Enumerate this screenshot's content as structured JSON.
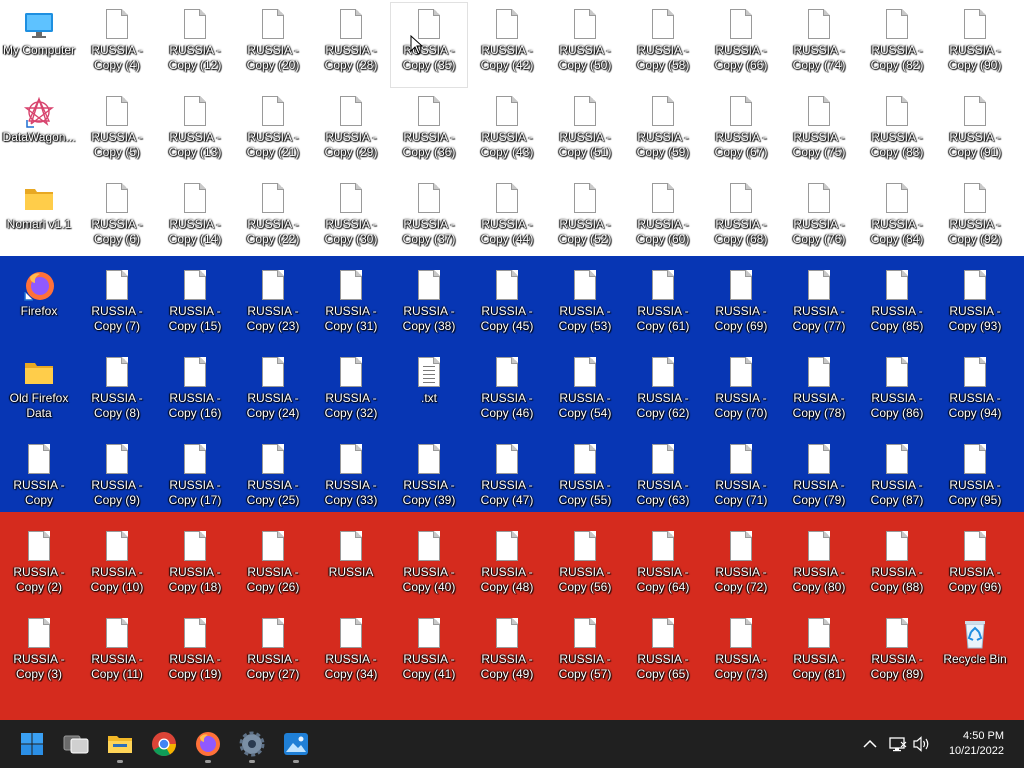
{
  "desktop": {
    "columns": [
      [
        {
          "label": "My Computer",
          "kind": "computer"
        },
        {
          "label": "DataWagon...",
          "kind": "app"
        },
        {
          "label": "Nomari v1.1",
          "kind": "folder"
        },
        {
          "label": "Firefox",
          "kind": "firefox"
        },
        {
          "label": "Old Firefox Data",
          "kind": "folder"
        },
        {
          "label": "RUSSIA - Copy",
          "kind": "file"
        },
        {
          "label": "RUSSIA - Copy (2)",
          "kind": "file"
        },
        {
          "label": "RUSSIA - Copy (3)",
          "kind": "file"
        }
      ],
      [
        {
          "label": "RUSSIA - Copy (4)",
          "kind": "file"
        },
        {
          "label": "RUSSIA - Copy (5)",
          "kind": "file"
        },
        {
          "label": "RUSSIA - Copy (6)",
          "kind": "file"
        },
        {
          "label": "RUSSIA - Copy (7)",
          "kind": "file"
        },
        {
          "label": "RUSSIA - Copy (8)",
          "kind": "file"
        },
        {
          "label": "RUSSIA - Copy (9)",
          "kind": "file"
        },
        {
          "label": "RUSSIA - Copy (10)",
          "kind": "file"
        },
        {
          "label": "RUSSIA - Copy (11)",
          "kind": "file"
        }
      ],
      [
        {
          "label": "RUSSIA - Copy (12)",
          "kind": "file"
        },
        {
          "label": "RUSSIA - Copy (13)",
          "kind": "file"
        },
        {
          "label": "RUSSIA - Copy (14)",
          "kind": "file"
        },
        {
          "label": "RUSSIA - Copy (15)",
          "kind": "file"
        },
        {
          "label": "RUSSIA - Copy (16)",
          "kind": "file"
        },
        {
          "label": "RUSSIA - Copy (17)",
          "kind": "file"
        },
        {
          "label": "RUSSIA - Copy (18)",
          "kind": "file"
        },
        {
          "label": "RUSSIA - Copy (19)",
          "kind": "file"
        }
      ],
      [
        {
          "label": "RUSSIA - Copy (20)",
          "kind": "file"
        },
        {
          "label": "RUSSIA - Copy (21)",
          "kind": "file"
        },
        {
          "label": "RUSSIA - Copy (22)",
          "kind": "file"
        },
        {
          "label": "RUSSIA - Copy (23)",
          "kind": "file"
        },
        {
          "label": "RUSSIA - Copy (24)",
          "kind": "file"
        },
        {
          "label": "RUSSIA - Copy (25)",
          "kind": "file"
        },
        {
          "label": "RUSSIA - Copy (26)",
          "kind": "file"
        },
        {
          "label": "RUSSIA - Copy (27)",
          "kind": "file"
        }
      ],
      [
        {
          "label": "RUSSIA - Copy (28)",
          "kind": "file"
        },
        {
          "label": "RUSSIA - Copy (29)",
          "kind": "file"
        },
        {
          "label": "RUSSIA - Copy (30)",
          "kind": "file"
        },
        {
          "label": "RUSSIA - Copy (31)",
          "kind": "file"
        },
        {
          "label": "RUSSIA - Copy (32)",
          "kind": "file"
        },
        {
          "label": "RUSSIA - Copy (33)",
          "kind": "file"
        },
        {
          "label": "RUSSIA",
          "kind": "file"
        },
        {
          "label": "RUSSIA - Copy (34)",
          "kind": "file"
        }
      ],
      [
        {
          "label": "RUSSIA - Copy (35)",
          "kind": "file",
          "hover": true
        },
        {
          "label": "RUSSIA - Copy (36)",
          "kind": "file"
        },
        {
          "label": "RUSSIA - Copy (37)",
          "kind": "file"
        },
        {
          "label": "RUSSIA - Copy (38)",
          "kind": "file"
        },
        {
          "label": ".txt",
          "kind": "txt"
        },
        {
          "label": "RUSSIA - Copy (39)",
          "kind": "file"
        },
        {
          "label": "RUSSIA - Copy (40)",
          "kind": "file"
        },
        {
          "label": "RUSSIA - Copy (41)",
          "kind": "file"
        }
      ],
      [
        {
          "label": "RUSSIA - Copy (42)",
          "kind": "file"
        },
        {
          "label": "RUSSIA - Copy (43)",
          "kind": "file"
        },
        {
          "label": "RUSSIA - Copy (44)",
          "kind": "file"
        },
        {
          "label": "RUSSIA - Copy (45)",
          "kind": "file"
        },
        {
          "label": "RUSSIA - Copy (46)",
          "kind": "file"
        },
        {
          "label": "RUSSIA - Copy (47)",
          "kind": "file"
        },
        {
          "label": "RUSSIA - Copy (48)",
          "kind": "file"
        },
        {
          "label": "RUSSIA - Copy (49)",
          "kind": "file"
        }
      ],
      [
        {
          "label": "RUSSIA - Copy (50)",
          "kind": "file"
        },
        {
          "label": "RUSSIA - Copy (51)",
          "kind": "file"
        },
        {
          "label": "RUSSIA - Copy (52)",
          "kind": "file"
        },
        {
          "label": "RUSSIA - Copy (53)",
          "kind": "file"
        },
        {
          "label": "RUSSIA - Copy (54)",
          "kind": "file"
        },
        {
          "label": "RUSSIA - Copy (55)",
          "kind": "file"
        },
        {
          "label": "RUSSIA - Copy (56)",
          "kind": "file"
        },
        {
          "label": "RUSSIA - Copy (57)",
          "kind": "file"
        }
      ],
      [
        {
          "label": "RUSSIA - Copy (58)",
          "kind": "file"
        },
        {
          "label": "RUSSIA - Copy (59)",
          "kind": "file"
        },
        {
          "label": "RUSSIA - Copy (60)",
          "kind": "file"
        },
        {
          "label": "RUSSIA - Copy (61)",
          "kind": "file"
        },
        {
          "label": "RUSSIA - Copy (62)",
          "kind": "file"
        },
        {
          "label": "RUSSIA - Copy (63)",
          "kind": "file"
        },
        {
          "label": "RUSSIA - Copy (64)",
          "kind": "file"
        },
        {
          "label": "RUSSIA - Copy (65)",
          "kind": "file"
        }
      ],
      [
        {
          "label": "RUSSIA - Copy (66)",
          "kind": "file"
        },
        {
          "label": "RUSSIA - Copy (67)",
          "kind": "file"
        },
        {
          "label": "RUSSIA - Copy (68)",
          "kind": "file"
        },
        {
          "label": "RUSSIA - Copy (69)",
          "kind": "file"
        },
        {
          "label": "RUSSIA - Copy (70)",
          "kind": "file"
        },
        {
          "label": "RUSSIA - Copy (71)",
          "kind": "file"
        },
        {
          "label": "RUSSIA - Copy (72)",
          "kind": "file"
        },
        {
          "label": "RUSSIA - Copy (73)",
          "kind": "file"
        }
      ],
      [
        {
          "label": "RUSSIA - Copy (74)",
          "kind": "file"
        },
        {
          "label": "RUSSIA - Copy (75)",
          "kind": "file"
        },
        {
          "label": "RUSSIA - Copy (76)",
          "kind": "file"
        },
        {
          "label": "RUSSIA - Copy (77)",
          "kind": "file"
        },
        {
          "label": "RUSSIA - Copy (78)",
          "kind": "file"
        },
        {
          "label": "RUSSIA - Copy (79)",
          "kind": "file"
        },
        {
          "label": "RUSSIA - Copy (80)",
          "kind": "file"
        },
        {
          "label": "RUSSIA - Copy (81)",
          "kind": "file"
        }
      ],
      [
        {
          "label": "RUSSIA - Copy (82)",
          "kind": "file"
        },
        {
          "label": "RUSSIA - Copy (83)",
          "kind": "file"
        },
        {
          "label": "RUSSIA - Copy (84)",
          "kind": "file"
        },
        {
          "label": "RUSSIA - Copy (85)",
          "kind": "file"
        },
        {
          "label": "RUSSIA - Copy (86)",
          "kind": "file"
        },
        {
          "label": "RUSSIA - Copy (87)",
          "kind": "file"
        },
        {
          "label": "RUSSIA - Copy (88)",
          "kind": "file"
        },
        {
          "label": "RUSSIA - Copy (89)",
          "kind": "file"
        }
      ],
      [
        {
          "label": "RUSSIA - Copy (90)",
          "kind": "file"
        },
        {
          "label": "RUSSIA - Copy (91)",
          "kind": "file"
        },
        {
          "label": "RUSSIA - Copy (92)",
          "kind": "file"
        },
        {
          "label": "RUSSIA - Copy (93)",
          "kind": "file"
        },
        {
          "label": "RUSSIA - Copy (94)",
          "kind": "file"
        },
        {
          "label": "RUSSIA - Copy (95)",
          "kind": "file"
        },
        {
          "label": "RUSSIA - Copy (96)",
          "kind": "file"
        },
        {
          "label": "Recycle Bin",
          "kind": "recycle"
        }
      ]
    ]
  },
  "wallpaper": {
    "stripes": [
      "#ffffff",
      "#0736b4",
      "#d52b1e"
    ]
  },
  "taskbar": {
    "background": "#202020",
    "pinned": [
      {
        "name": "start-button",
        "icon": "windows-logo-icon",
        "running": false
      },
      {
        "name": "task-view-button",
        "icon": "task-view-icon",
        "running": false
      },
      {
        "name": "file-explorer-button",
        "icon": "folder-icon",
        "running": true
      },
      {
        "name": "chrome-button",
        "icon": "chrome-icon",
        "running": false
      },
      {
        "name": "firefox-button",
        "icon": "firefox-icon",
        "running": true
      },
      {
        "name": "settings-button",
        "icon": "gear-icon",
        "running": true
      },
      {
        "name": "photos-button",
        "icon": "photos-icon",
        "running": true
      }
    ],
    "tray": {
      "time": "4:50 PM",
      "date": "10/21/2022"
    }
  }
}
